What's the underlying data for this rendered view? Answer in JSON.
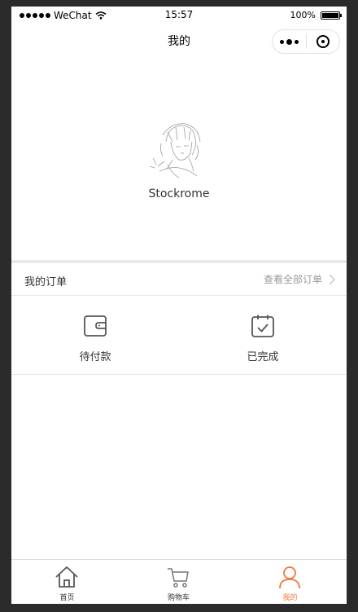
{
  "status_bar": {
    "carrier": "WeChat",
    "time": "15:57",
    "battery": "100%"
  },
  "nav": {
    "title": "我的"
  },
  "profile": {
    "username": "Stockrome",
    "avatar_icon": "avatar-sketch-icon"
  },
  "orders": {
    "title": "我的订单",
    "view_all": "查看全部订单",
    "statuses": [
      {
        "label": "待付款",
        "icon": "wallet-icon"
      },
      {
        "label": "已完成",
        "icon": "calendar-check-icon"
      }
    ]
  },
  "tab_bar": {
    "items": [
      {
        "label": "首页",
        "icon": "home-icon",
        "active": false
      },
      {
        "label": "购物车",
        "icon": "cart-icon",
        "active": false
      },
      {
        "label": "我的",
        "icon": "user-icon",
        "active": true
      }
    ]
  },
  "colors": {
    "accent": "#f0773a",
    "background": "#ffffff",
    "divider": "#e8e8e8"
  }
}
